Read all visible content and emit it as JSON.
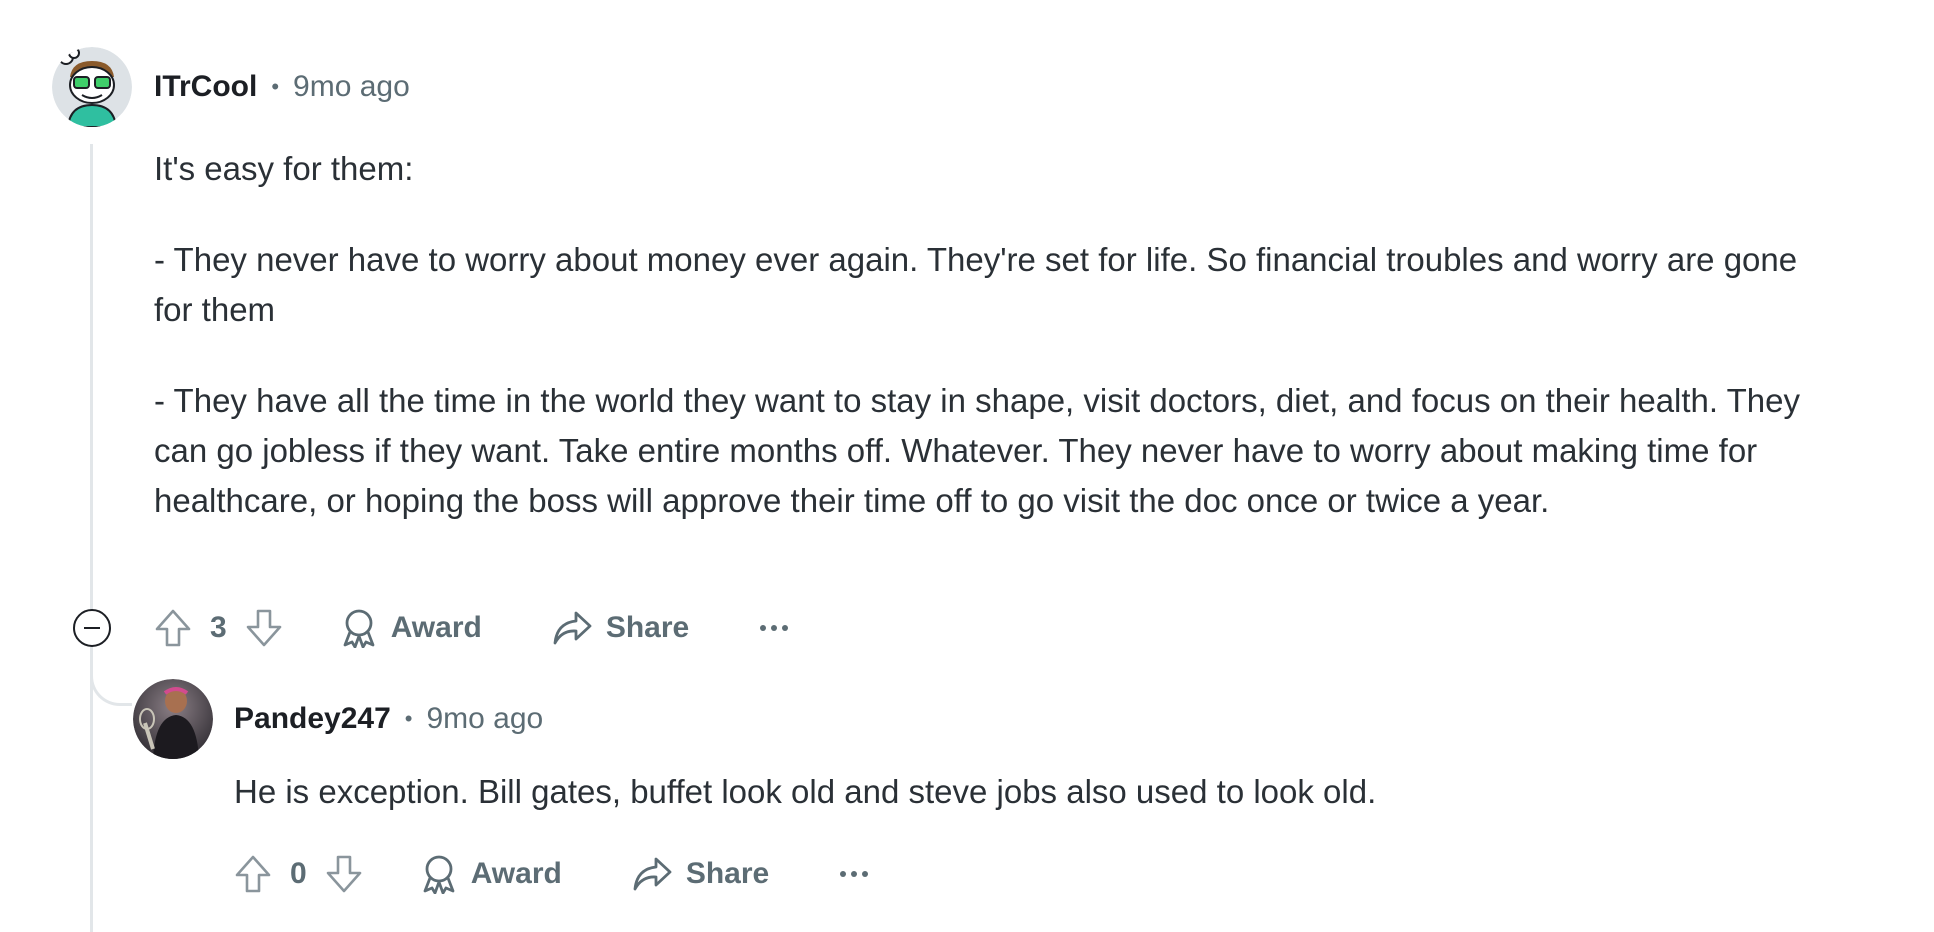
{
  "comments": [
    {
      "username": "ITrCool",
      "separator": "•",
      "time": "9mo ago",
      "avatar_icon": "snoo-avatar-icon",
      "paragraphs": [
        "It's easy for them:",
        "- They never have to worry about money ever again. They're set for life. So financial troubles and worry are gone for them",
        "- They have all the time in the world they want to stay in shape, visit doctors, diet, and focus on their health. They can go jobless if they want. Take entire months off. Whatever. They never have to worry about making time for healthcare, or hoping the boss will approve their time off to go visit the doc once or twice a year."
      ],
      "votes": "3",
      "award_label": "Award",
      "share_label": "Share"
    },
    {
      "username": "Pandey247",
      "separator": "•",
      "time": "9mo ago",
      "avatar_icon": "user-photo-avatar",
      "paragraphs": [
        "He is exception. Bill gates, buffet look old and steve jobs also used to look old."
      ],
      "votes": "0",
      "award_label": "Award",
      "share_label": "Share"
    }
  ],
  "colors": {
    "text": "#2a3036",
    "meta": "#5c6c74",
    "thread_line": "#e2e6e9"
  }
}
